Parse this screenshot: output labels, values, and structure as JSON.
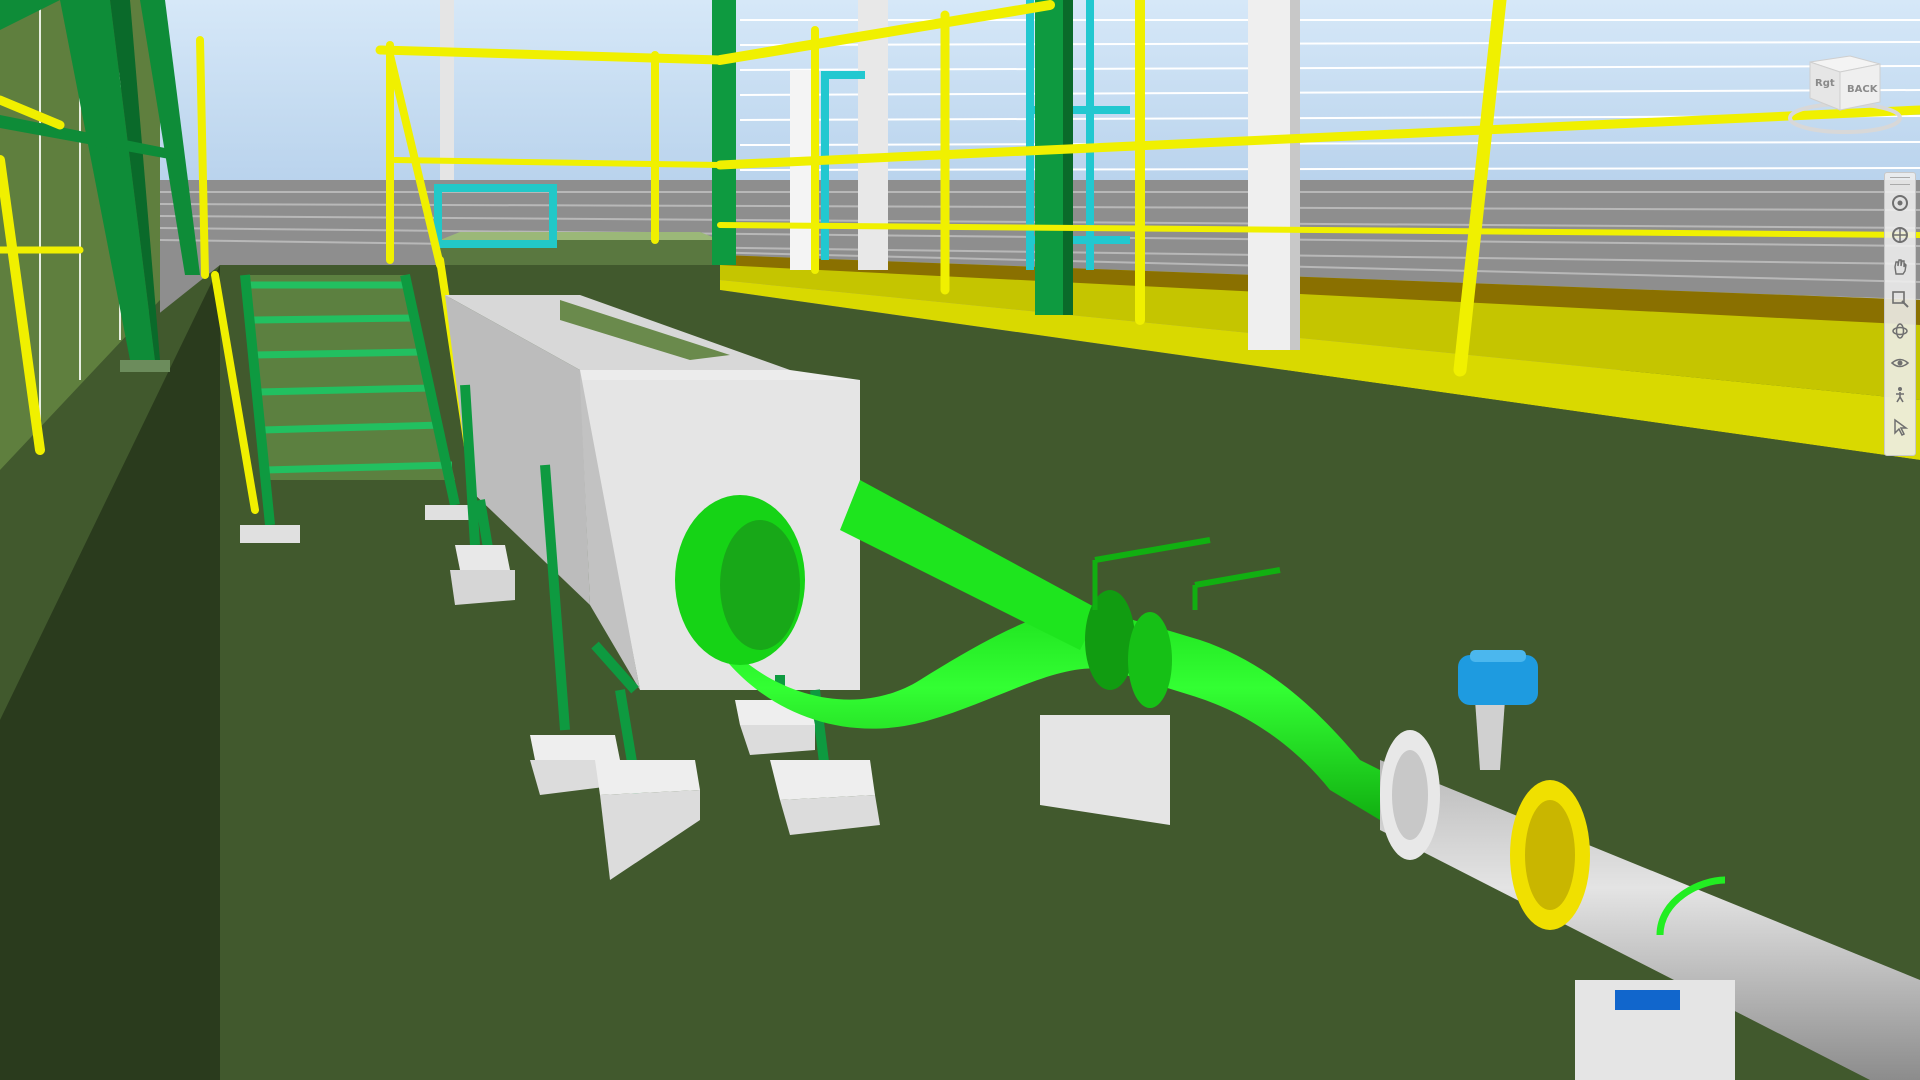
{
  "window": {
    "background_color": "#3f5a2e"
  },
  "viewcube": {
    "front_face_label": "BACK",
    "side_face_label": "Rgt"
  },
  "navigation_bar": {
    "tools": [
      {
        "name": "steering-wheel",
        "icon": "steering-wheel-icon"
      },
      {
        "name": "full-navigation-wheel",
        "icon": "full-wheel-icon"
      },
      {
        "name": "pan",
        "icon": "hand-pan-icon"
      },
      {
        "name": "zoom-window",
        "icon": "zoom-window-icon"
      },
      {
        "name": "orbit",
        "icon": "orbit-icon"
      },
      {
        "name": "look",
        "icon": "look-around-icon"
      },
      {
        "name": "walk",
        "icon": "walk-icon"
      },
      {
        "name": "select",
        "icon": "select-arrow-icon"
      }
    ]
  },
  "colors": {
    "floor": "#41592d",
    "handrail_yellow": "#f0f000",
    "steel_green": "#109a40",
    "pipe_green": "#22ee22",
    "concrete": "#e2e2e2",
    "sky": "#c4dcf2",
    "flowmeter_blue": "#1e9be0"
  }
}
